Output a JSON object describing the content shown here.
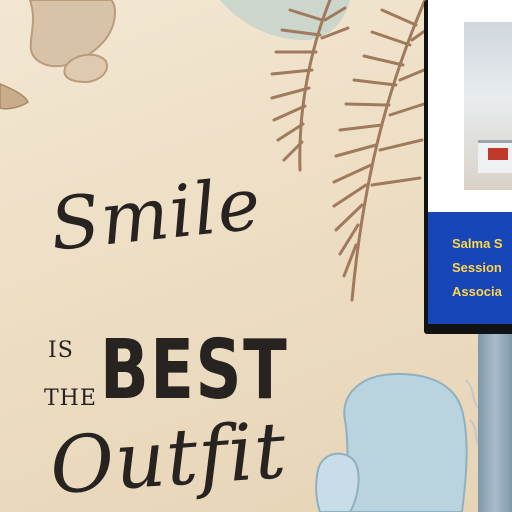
{
  "quote": {
    "line1": "Smile",
    "line2_prefix": "IS",
    "line3_prefix": "THE",
    "line2_main": "BEST",
    "line4": "Outfit"
  },
  "screen": {
    "line1": "Salma S",
    "line2": "Session",
    "line3": "Associa"
  },
  "colors": {
    "wall": "#efe1c9",
    "lettering": "#262320",
    "leaf": "#a07a5c",
    "blue_blob": "#b9d3df",
    "screen_banner": "#1746b8",
    "screen_text": "#ffd54a"
  }
}
